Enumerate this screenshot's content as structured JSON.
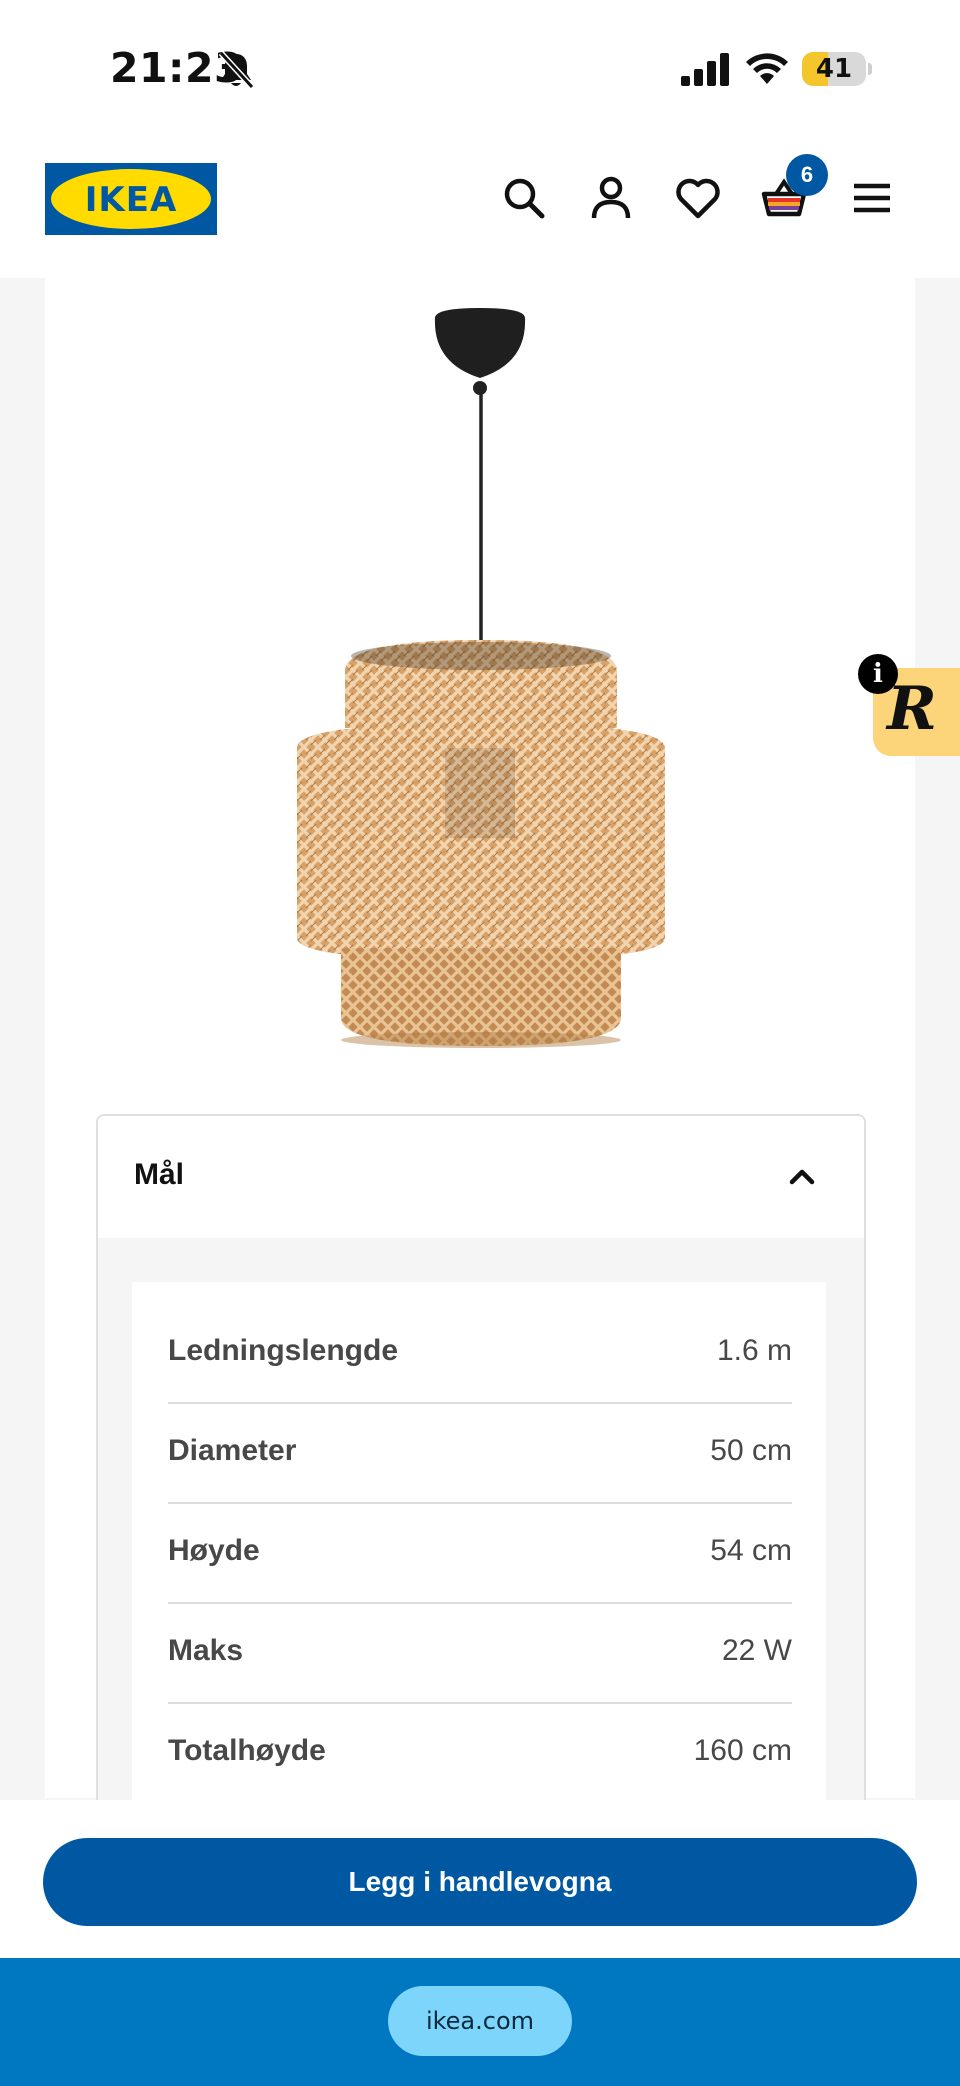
{
  "status_bar": {
    "time": "21:23",
    "battery": "41",
    "battery_level": 0.41
  },
  "header": {
    "logo_text": "IKEA",
    "cart_count": "6"
  },
  "colors": {
    "brand_blue": "#0058a3",
    "brand_yellow": "#ffdb00",
    "browser_bar": "#0077c1",
    "url_pill": "#7dd5fb",
    "rakuten_yellow": "#fcd47a"
  },
  "icons": [
    "bell-slash-icon",
    "signal-icon",
    "wifi-icon",
    "search-icon",
    "user-icon",
    "heart-icon",
    "cart-icon",
    "menu-icon",
    "chevron-up-icon",
    "info-icon"
  ],
  "accordion": {
    "title": "Mål",
    "rows": [
      {
        "label": "Ledningslengde",
        "value": "1.6 m"
      },
      {
        "label": "Diameter",
        "value": "50 cm"
      },
      {
        "label": "Høyde",
        "value": "54 cm"
      },
      {
        "label": "Maks",
        "value": "22 W"
      },
      {
        "label": "Totalhøyde",
        "value": "160 cm"
      }
    ]
  },
  "rakuten": {
    "info": "i",
    "logo": "R"
  },
  "add_to_cart_label": "Legg i handlevogna",
  "browser": {
    "url": "ikea.com"
  }
}
